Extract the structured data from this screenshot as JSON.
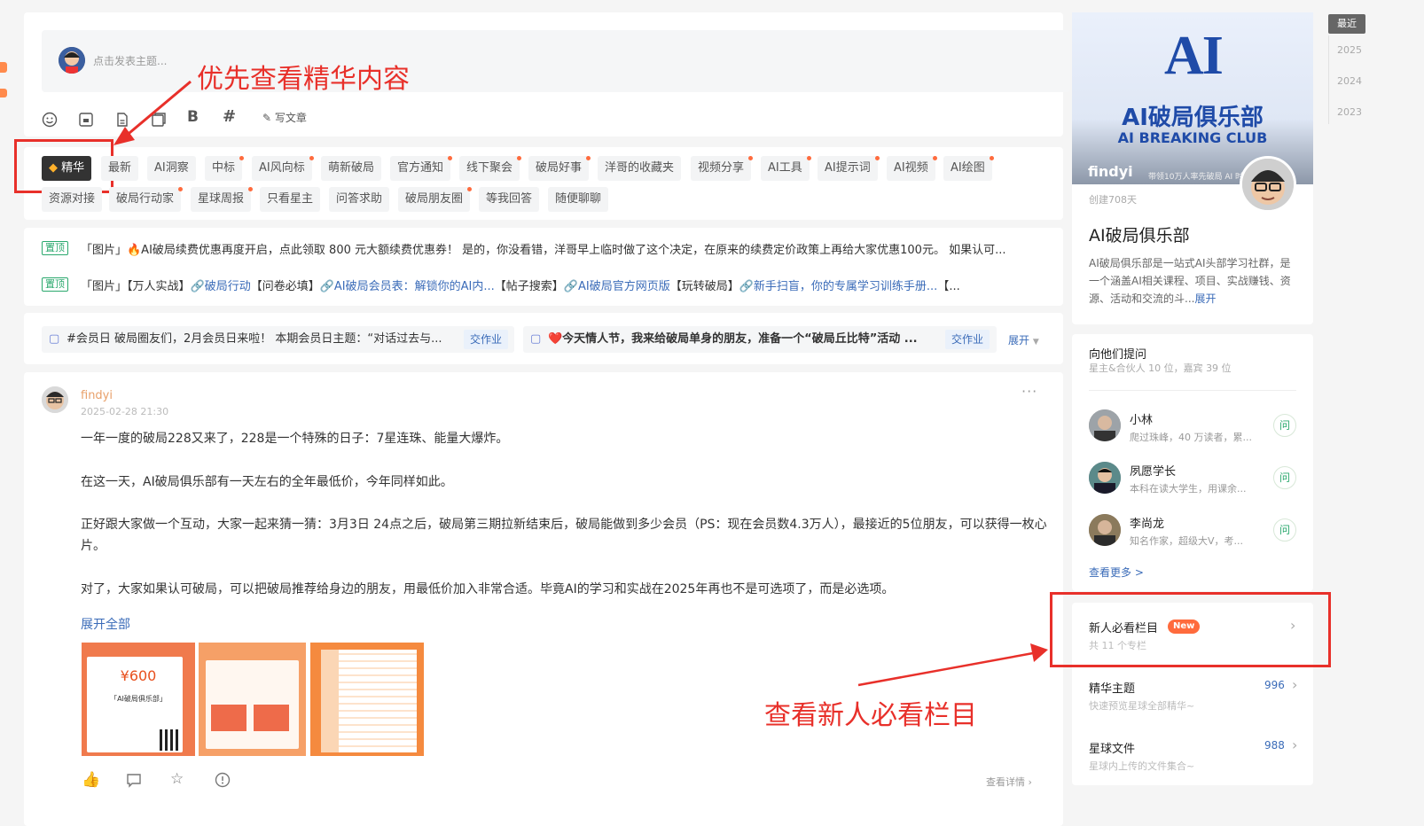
{
  "composer": {
    "placeholder": "点击发表主题...",
    "tools": [
      "smiley-icon",
      "image-icon",
      "file-icon",
      "copy-icon",
      "bold-icon",
      "hashtag-icon"
    ],
    "write_article": "写文章"
  },
  "tags": {
    "active": "精华",
    "row1": [
      "最新",
      "AI洞察",
      "中标",
      "AI风向标",
      "萌新破局",
      "官方通知",
      "线下聚会",
      "破局好事",
      "洋哥的收藏夹",
      "视频分享",
      "AI工具",
      "AI提示词",
      "AI视频",
      "AI绘图"
    ],
    "row2": [
      "资源对接",
      "破局行动家",
      "星球周报",
      "只看星主",
      "问答求助",
      "破局朋友圈",
      "等我回答",
      "随便聊聊"
    ]
  },
  "pinned": {
    "tag": "置顶",
    "line1": "「图片」🔥AI破局续费优惠再度开启，点此领取 800 元大额续费优惠券！ 是的，你没看错，洋哥早上临时做了这个决定，在原来的续费定价政策上再给大家优惠100元。 如果认可...",
    "line2_prefix": "「图片」【万人实战】",
    "line2_link1": "🔗破局行动",
    "line2_mid1": "【问卷必填】",
    "line2_link2": "🔗AI破局会员表：解锁你的AI内...",
    "line2_mid2": "【帖子搜索】",
    "line2_link3": "🔗AI破局官方网页版",
    "line2_mid3": "【玩转破局】",
    "line2_link4": "🔗新手扫盲，你的专属学习训练手册...",
    "line2_tail": "【..."
  },
  "homework": {
    "item1": "#会员日 破局圈友们，2月会员日来啦！ 本期会员日主题：“对话过去与...",
    "item2": "❤️今天情人节，我来给破局单身的朋友，准备一个“破局丘比特”活动 ...",
    "btn": "交作业",
    "expand": "展开"
  },
  "post": {
    "author": "findyi",
    "time": "2025-02-28 21:30",
    "p1": "一年一度的破局228又来了，228是一个特殊的日子：7星连珠、能量大爆炸。",
    "p2": "在这一天，AI破局俱乐部有一天左右的全年最低价，今年同样如此。",
    "p3": "正好跟大家做一个互动，大家一起来猜一猜：3月3日 24点之后，破局第三期拉新结束后，破局能做到多少会员（PS：现在会员数4.3万人），最接近的5位朋友，可以获得一枚心片。",
    "p4": "对了，大家如果认可破局，可以把破局推荐给身边的朋友，用最低价加入非常合适。毕竟AI的学习和实战在2025年再也不是可选项了，而是必选项。",
    "expand": "展开全部",
    "img1_price": "¥600",
    "img1_name": "「AI破局俱乐部」",
    "detail": "查看详情"
  },
  "club": {
    "logo_mark": "AI",
    "logo_cn": "AI破局俱乐部",
    "logo_en": "AI BREAKING CLUB",
    "owner": "findyi",
    "owner_sub": "带领10万人率先破局 AI 时",
    "created": "创建708天",
    "name": "AI破局俱乐部",
    "desc": "AI破局俱乐部是一站式AI头部学习社群，是一个涵盖AI相关课程、项目、实战赚钱、资源、活动和交流的斗...",
    "desc_more": "展开"
  },
  "ask": {
    "title": "向他们提问",
    "sub": "星主&合伙人 10 位，嘉宾 39 位",
    "people": [
      {
        "name": "小林",
        "desc": "爬过珠峰，40 万读者，累..."
      },
      {
        "name": "夙愿学长",
        "desc": "本科在读大学生，用课余..."
      },
      {
        "name": "李尚龙",
        "desc": "知名作家，超级大V，考..."
      }
    ],
    "btn": "问",
    "more": "查看更多 >"
  },
  "columns": {
    "title": "新人必看栏目",
    "badge": "New",
    "sub": "共 11 个专栏"
  },
  "digest": {
    "title": "精华主题",
    "sub": "快速预览星球全部精华~",
    "count": "996"
  },
  "files": {
    "title": "星球文件",
    "sub": "星球内上传的文件集合~",
    "count": "988"
  },
  "timeline": {
    "current": "最近",
    "years": [
      "2025",
      "2024",
      "2023"
    ]
  },
  "annotations": {
    "top": "优先查看精华内容",
    "bottom": "查看新人必看栏目"
  },
  "colors": {
    "annotation": "#e8302a",
    "accent_orange": "#ff6b3d",
    "link_blue": "#3a6bb8",
    "pin_green": "#2aa86d"
  }
}
